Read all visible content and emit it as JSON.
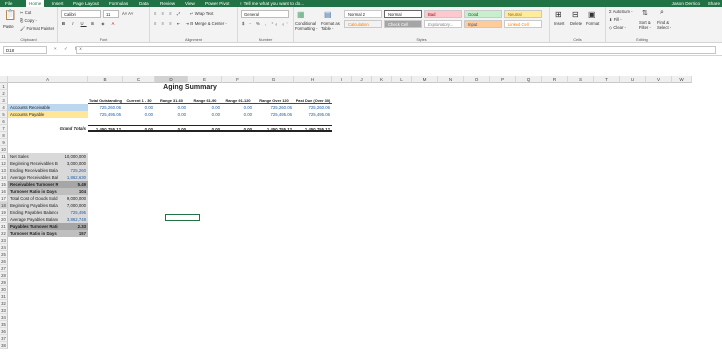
{
  "tabs": [
    "File",
    "Home",
    "Insert",
    "Page Layout",
    "Formulas",
    "Data",
    "Review",
    "View",
    "Power Pivot",
    "♀ Tell me what you want to do..."
  ],
  "user": "Jason Derrico",
  "share": "Share",
  "ribbon": {
    "clipboard": {
      "paste": "Paste",
      "cut": "Cut",
      "copy": "Copy -",
      "painter": "Format Painter",
      "label": "Clipboard"
    },
    "font": {
      "name": "Calibri",
      "size": "11",
      "label": "Font"
    },
    "alignment": {
      "wrap": "Wrap Text",
      "merge": "Merge & Center -",
      "label": "Alignment"
    },
    "number": {
      "format": "General",
      "label": "Number"
    },
    "styles": {
      "cond": "Conditional Formatting -",
      "table": "Format as Table -",
      "cells": [
        "Normal 2",
        "Normal",
        "Bad",
        "Good",
        "Neutral",
        "Calculation",
        "Check Cell",
        "Explanatory...",
        "Input",
        "Linked Cell"
      ],
      "label": "Styles"
    },
    "cells": {
      "insert": "Insert",
      "delete": "Delete",
      "format": "Format",
      "label": "Cells"
    },
    "editing": {
      "autosum": "AutoSum -",
      "fill": "Fill -",
      "clear": "Clear -",
      "sort": "Sort & Filter -",
      "find": "Find & Select -",
      "label": "Editing"
    }
  },
  "formula_bar": {
    "name_box": "D18",
    "fx": "× ✓ fx",
    "value": ""
  },
  "columns": [
    "A",
    "B",
    "C",
    "D",
    "E",
    "F",
    "G",
    "H",
    "I",
    "J",
    "K",
    "L",
    "M",
    "N",
    "O",
    "P",
    "Q",
    "R",
    "S",
    "T",
    "U",
    "V",
    "W"
  ],
  "rows": [
    "1",
    "2",
    "3",
    "4",
    "5",
    "6",
    "7",
    "8",
    "9",
    "10",
    "11",
    "12",
    "13",
    "14",
    "15",
    "16",
    "17",
    "18",
    "19",
    "20",
    "21",
    "22",
    "23",
    "24",
    "25",
    "26",
    "27",
    "28",
    "29",
    "30",
    "31",
    "32",
    "33",
    "34",
    "35",
    "36",
    "37",
    "38"
  ],
  "sheet": {
    "title": "Aging Summary",
    "headers": [
      "Total Outstanding",
      "Current 1 - 30",
      "Range 31-60",
      "Range 61-90",
      "Range 91-120",
      "Range Over 120",
      "Past Due (Over 30)"
    ],
    "receivable": {
      "label": "Accounts Receivable",
      "values": [
        "725,260.06",
        "0.00",
        "0.00",
        "0.00",
        "0.00",
        "725,260.06",
        "725,260.06"
      ]
    },
    "payable": {
      "label": "Accounts Payable",
      "values": [
        "725,495.06",
        "0.00",
        "0.00",
        "0.00",
        "0.00",
        "725,495.06",
        "725,495.06"
      ]
    },
    "totals": {
      "label": "Grand Totals",
      "values": [
        "1,450,755.12",
        "0.00",
        "0.00",
        "0.00",
        "0.00",
        "1,450,755.12",
        "1,450,755.12"
      ]
    },
    "ratios": [
      {
        "label": "Net Sales",
        "value": "10,000,000",
        "style": "plain"
      },
      {
        "label": "Beginning Receivables  Balance",
        "value": "3,000,000",
        "style": "plain"
      },
      {
        "label": "Ending Receivables Balance",
        "value": "725,260",
        "style": "blue"
      },
      {
        "label": "Average Receivables Balance",
        "value": "1,862,630",
        "style": "blue"
      },
      {
        "label": "Receivables Turnover Ratio",
        "value": "5.49",
        "style": "dark"
      },
      {
        "label": "Turnover Ratio in Days",
        "value": "104",
        "style": "mid"
      },
      {
        "label": "Total Cost of Goods Sold",
        "value": "9,000,000",
        "style": "plain"
      },
      {
        "label": "Beginning Payables Balance",
        "value": "7,000,000",
        "style": "plain"
      },
      {
        "label": "Ending Payables Balance",
        "value": "725,495",
        "style": "blue"
      },
      {
        "label": "Average Payables Balance",
        "value": "3,862,748",
        "style": "blue"
      },
      {
        "label": "Payables Turnover Ratio",
        "value": "2.33",
        "style": "dark"
      },
      {
        "label": "Turnover Ratio in Days",
        "value": "157",
        "style": "mid"
      }
    ]
  }
}
